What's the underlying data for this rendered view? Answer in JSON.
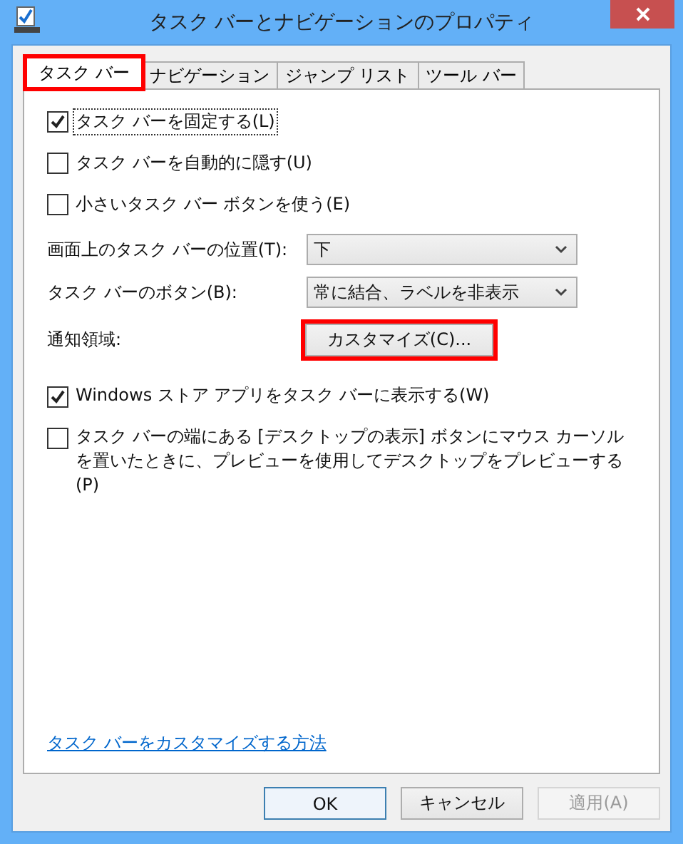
{
  "window": {
    "title": "タスク バーとナビゲーションのプロパティ"
  },
  "tabs": [
    {
      "label": "タスク バー",
      "selected": true,
      "highlighted": true
    },
    {
      "label": "ナビゲーション",
      "selected": false,
      "highlighted": false
    },
    {
      "label": "ジャンプ リスト",
      "selected": false,
      "highlighted": false
    },
    {
      "label": "ツール バー",
      "selected": false,
      "highlighted": false
    }
  ],
  "options": [
    {
      "label": "タスク バーを固定する(L)",
      "checked": true,
      "focused": true
    },
    {
      "label": "タスク バーを自動的に隠す(U)",
      "checked": false,
      "focused": false
    },
    {
      "label": "小さいタスク バー ボタンを使う(E)",
      "checked": false,
      "focused": false
    }
  ],
  "dropdowns": [
    {
      "label": "画面上のタスク バーの位置(T):",
      "value": "下"
    },
    {
      "label": "タスク バーのボタン(B):",
      "value": "常に結合、ラベルを非表示"
    }
  ],
  "notification": {
    "label": "通知領域:",
    "button": "カスタマイズ(C)...",
    "highlighted": true
  },
  "more_options": [
    {
      "label": "Windows ストア アプリをタスク バーに表示する(W)",
      "checked": true
    },
    {
      "label": "タスク バーの端にある [デスクトップの表示] ボタンにマウス カーソルを置いたときに、プレビューを使用してデスクトップをプレビューする(P)",
      "checked": false
    }
  ],
  "help_link": "タスク バーをカスタマイズする方法",
  "buttons": [
    {
      "label": "OK",
      "kind": "default"
    },
    {
      "label": "キャンセル",
      "kind": "normal"
    },
    {
      "label": "適用(A)",
      "kind": "disabled"
    }
  ]
}
